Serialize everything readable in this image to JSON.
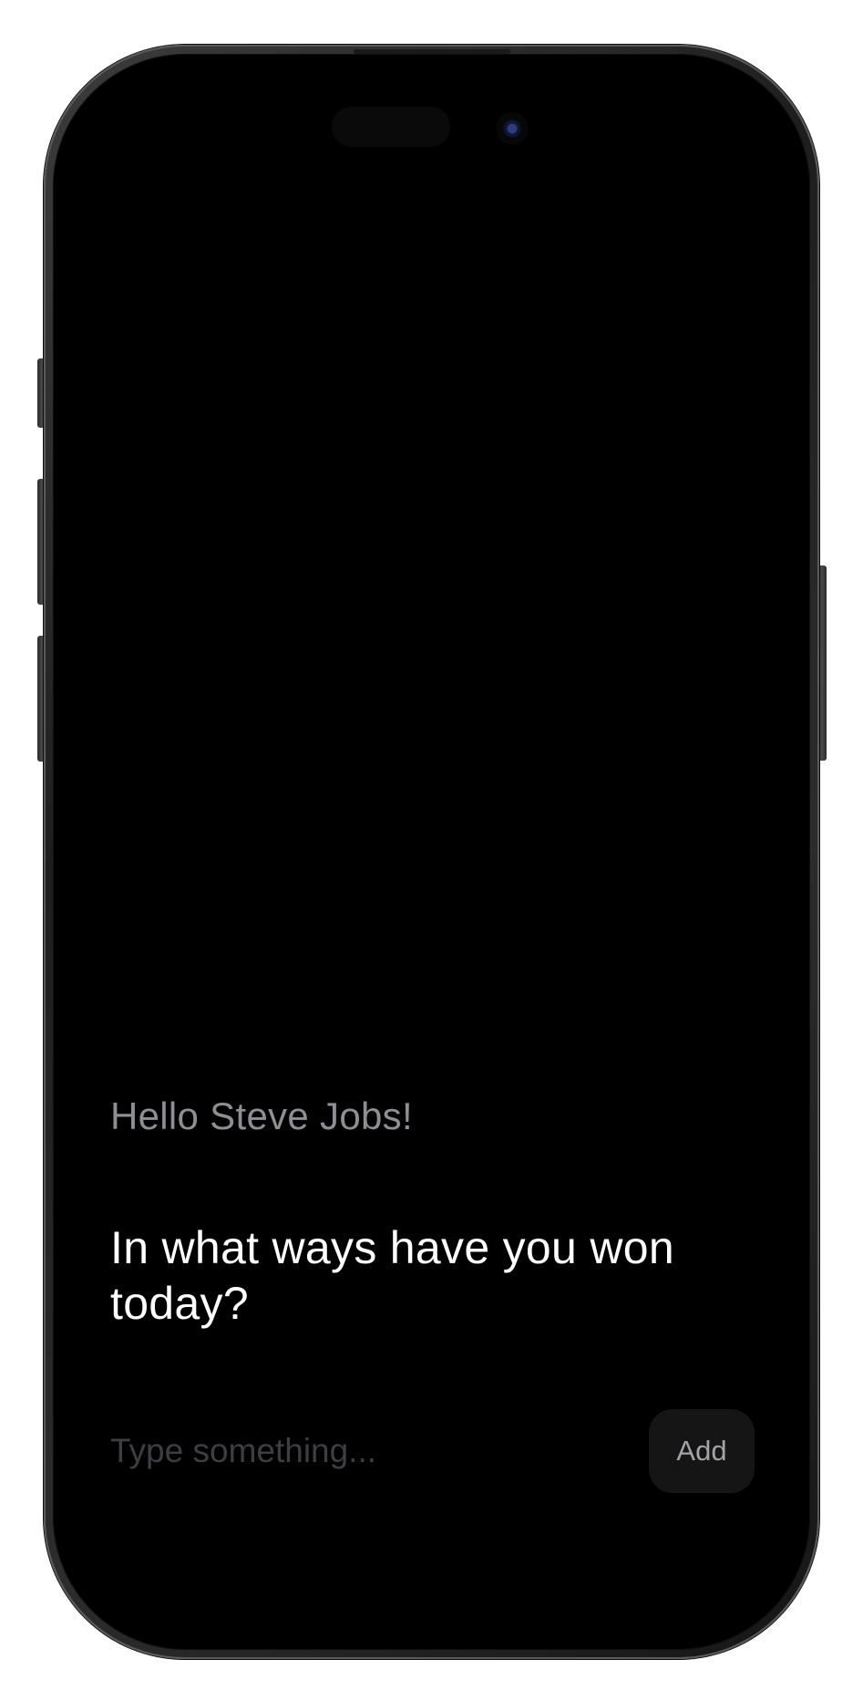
{
  "home": {
    "greeting": "Hello Steve Jobs!",
    "prompt_question": "In what ways have you won today?"
  },
  "entry": {
    "placeholder": "Type something...",
    "value": "",
    "add_label": "Add"
  },
  "colors": {
    "screen_background": "#000000",
    "greeting_text": "#8e8e93",
    "question_text": "#ffffff",
    "placeholder_text": "#3e3e42",
    "add_button_background": "#151515",
    "add_button_text": "#a3a3a8"
  }
}
